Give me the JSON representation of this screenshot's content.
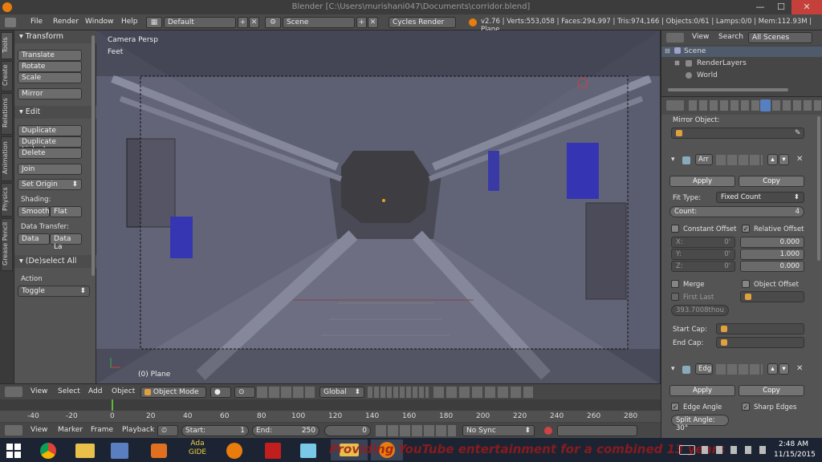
{
  "titlebar": {
    "title": "Blender [C:\\Users\\murishani047\\Documents\\corridor.blend]",
    "minimize": "—",
    "maximize": "☐",
    "close": "✕"
  },
  "infobar": {
    "menus": [
      "File",
      "Render",
      "Window",
      "Help"
    ],
    "layout": "Default",
    "scene": "Scene",
    "engine": "Cycles Render",
    "stats": "v2.76 | Verts:553,058 | Faces:294,997 | Tris:974,166 | Objects:0/61 | Lamps:0/0 | Mem:112.93M | Plane"
  },
  "tabs": [
    "Tools",
    "Create",
    "Relations",
    "Animation",
    "Physics",
    "Grease Pencil"
  ],
  "toolshelf": {
    "transform": {
      "title": "Transform",
      "buttons": [
        "Translate",
        "Rotate",
        "Scale",
        "Mirror"
      ]
    },
    "edit": {
      "title": "Edit",
      "buttons": [
        "Duplicate",
        "Duplicate Linked",
        "Delete",
        "Join"
      ],
      "set_origin": "Set Origin",
      "shading_label": "Shading:",
      "smooth": "Smooth",
      "flat": "Flat",
      "data_transfer_label": "Data Transfer:",
      "data": "Data",
      "data_layout": "Data La"
    },
    "deselect": {
      "title": "(De)select All",
      "action_label": "Action",
      "action_value": "Toggle"
    }
  },
  "viewport": {
    "camera": "Camera Persp",
    "units": "Feet",
    "object": "(0) Plane"
  },
  "outliner": {
    "menus": [
      "View",
      "Search"
    ],
    "filter": "All Scenes",
    "items": [
      "Scene",
      "RenderLayers",
      "World"
    ]
  },
  "props": {
    "mirror_object": "Mirror Object:",
    "array": {
      "name": "Arr",
      "apply": "Apply",
      "copy": "Copy",
      "fit_type_label": "Fit Type:",
      "fit_type": "Fixed Count",
      "count_label": "Count:",
      "count": "4",
      "constant_offset": "Constant Offset",
      "relative_offset": "Relative Offset",
      "x_label": "X:",
      "y_label": "Y:",
      "z_label": "Z:",
      "const_x": "0'",
      "const_y": "0'",
      "const_z": "0'",
      "rel_x": "0.000",
      "rel_y": "1.000",
      "rel_z": "0.000",
      "merge": "Merge",
      "object_offset": "Object Offset",
      "first_last": "First Last",
      "merge_dist": "393.7008thou",
      "start_cap": "Start Cap:",
      "end_cap": "End Cap:"
    },
    "edge": {
      "name": "Edg",
      "apply": "Apply",
      "copy": "Copy",
      "edge_angle": "Edge Angle",
      "sharp_edges": "Sharp Edges",
      "split_angle": "Split Angle: 30°"
    }
  },
  "viewport_header": {
    "menus": [
      "View",
      "Select",
      "Add",
      "Object"
    ],
    "mode": "Object Mode",
    "orientation": "Global"
  },
  "timeline": {
    "ticks": [
      "-40",
      "-20",
      "0",
      "20",
      "40",
      "60",
      "80",
      "100",
      "120",
      "140",
      "160",
      "180",
      "200",
      "220",
      "240",
      "260",
      "280"
    ],
    "current_frame_value": 0
  },
  "timeline_header": {
    "menus": [
      "View",
      "Marker",
      "Frame",
      "Playback"
    ],
    "start": "Start:",
    "start_value": "1",
    "end": "End:",
    "end_value": "250",
    "current": "0",
    "sync": "No Sync"
  },
  "taskbar": {
    "overlay": "Providing YouTube entertainment for a combined 13 years",
    "time": "2:48 AM",
    "date": "11/15/2015",
    "ada_label": "Ada\nGIDE"
  },
  "colors": {
    "accent": "#5680c2",
    "selected_tab": "#6e8fbd",
    "overlay_text": "#9b1a1a"
  }
}
